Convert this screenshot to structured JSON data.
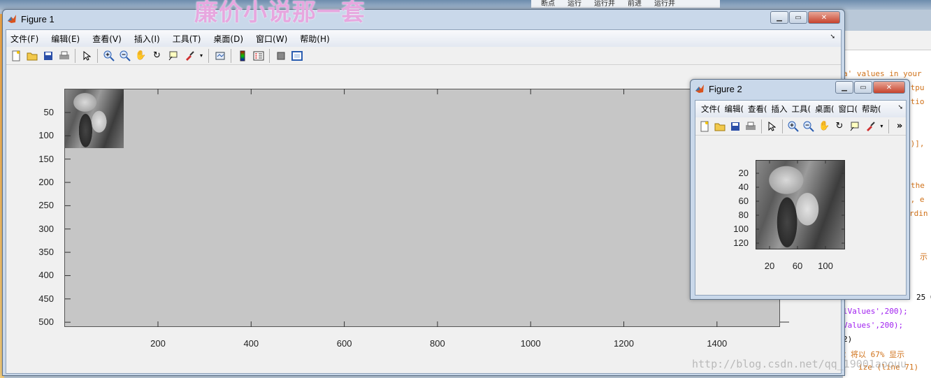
{
  "background": {
    "ribbon_items": [
      "断点",
      "运行",
      "运行并",
      "前进",
      "运行并"
    ],
    "overlay_text": "廉价小说那一套",
    "blog_watermark": "http://blog.csdn.net/qq_19001aoouu",
    "editor_lines": [
      {
        "text": "a' values in your",
        "color": "orange"
      },
      {
        "text": "utpu",
        "color": "orange"
      },
      {
        "text": "atio",
        "color": "orange"
      },
      {
        "text": ":",
        "color": "orange"
      },
      {
        "text": "2)],",
        "color": "orange"
      },
      {
        "text": "the",
        "color": "orange"
      },
      {
        "text": "e, e",
        "color": "orange"
      },
      {
        "text": "rdin",
        "color": "orange"
      },
      {
        "text": "示",
        "color": "orange"
      },
      {
        "text": "25 0",
        "color": "black"
      },
      {
        "text": "lValues',200);",
        "color": "purple"
      },
      {
        "text": "Values',200);",
        "color": "purple"
      },
      {
        "text": "2)",
        "color": "black"
      },
      {
        "text": "：将以 67% 显示",
        "color": "orange"
      },
      {
        "text": "ize  (line 71)",
        "color": "orange"
      }
    ]
  },
  "figure1": {
    "title": "Figure 1",
    "menu": [
      "文件(F)",
      "编辑(E)",
      "查看(V)",
      "插入(I)",
      "工具(T)",
      "桌面(D)",
      "窗口(W)",
      "帮助(H)"
    ],
    "toolbar_icons": [
      "new-file-icon",
      "open-folder-icon",
      "save-icon",
      "print-icon",
      "pointer-icon",
      "zoom-in-icon",
      "zoom-out-icon",
      "pan-hand-icon",
      "rotate-3d-icon",
      "data-cursor-icon",
      "brush-icon",
      "link-plot-icon",
      "colorbar-icon",
      "legend-icon",
      "hide-plot-tools-icon",
      "show-plot-tools-icon"
    ],
    "y_ticks": [
      "50",
      "100",
      "150",
      "200",
      "250",
      "300",
      "350",
      "400",
      "450",
      "500"
    ],
    "x_ticks": [
      "200",
      "400",
      "600",
      "800",
      "1000",
      "1200",
      "1400"
    ]
  },
  "figure2": {
    "title": "Figure 2",
    "menu": [
      "文件(",
      "编辑(",
      "查看(",
      "插入",
      "工具(",
      "桌面(",
      "窗口(",
      "帮助("
    ],
    "overflow_label": "»",
    "y_ticks": [
      "20",
      "40",
      "60",
      "80",
      "100",
      "120"
    ],
    "x_ticks": [
      "20",
      "60",
      "100"
    ]
  }
}
